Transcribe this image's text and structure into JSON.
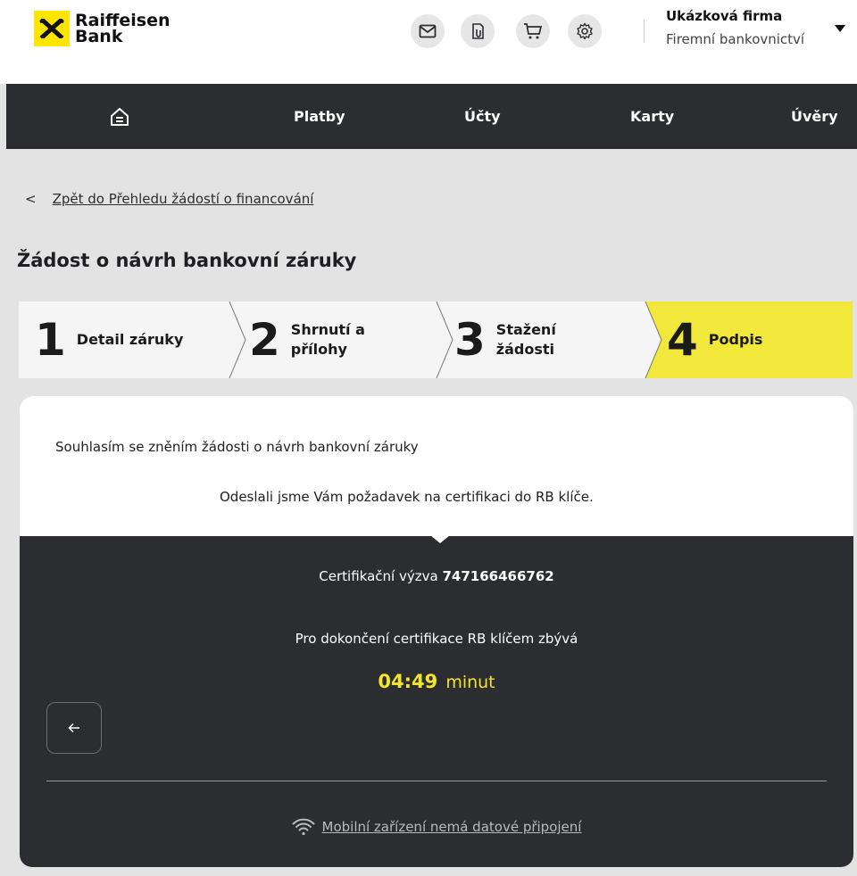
{
  "brand": {
    "line1": "Raiffeisen",
    "line2": "Bank",
    "color": "#fee600"
  },
  "header": {
    "icons": [
      "mail-icon",
      "documents-icon",
      "cart-icon",
      "settings-icon"
    ],
    "company_name": "Ukázková firma",
    "segment": "Firemní bankovnictví"
  },
  "nav": {
    "items": [
      {
        "label": "Platby"
      },
      {
        "label": "Účty"
      },
      {
        "label": "Karty"
      },
      {
        "label": "Úvěry"
      }
    ]
  },
  "breadcrumb": {
    "back_label": "Zpět do Přehledu žádostí o financování"
  },
  "page": {
    "title": "Žádost o návrh bankovní záruky"
  },
  "stepper": {
    "steps": [
      {
        "number": "1",
        "label_line1": "Detail záruky",
        "label_line2": ""
      },
      {
        "number": "2",
        "label_line1": "Shrnutí a",
        "label_line2": "přílohy"
      },
      {
        "number": "3",
        "label_line1": "Stažení",
        "label_line2": "žádosti"
      },
      {
        "number": "4",
        "label_line1": "Podpis",
        "label_line2": ""
      }
    ],
    "active_step": 4,
    "active_color": "#f1e83b"
  },
  "card": {
    "consent_text": "Souhlasím se zněním žádosti o návrh bankovní záruky",
    "sent_text": "Odeslali jsme Vám požadavek na certifikaci do RB klíče.",
    "challenge_label": "Certifikační výzva",
    "challenge_code": "747166466762",
    "remaining_label": "Pro dokončení certifikace RB klíčem zbývá",
    "timer_value": "04:49",
    "timer_unit": "minut",
    "timer_color": "#f5e52a",
    "mobile_link": "Mobilní zařízení nemá datové připojení"
  }
}
